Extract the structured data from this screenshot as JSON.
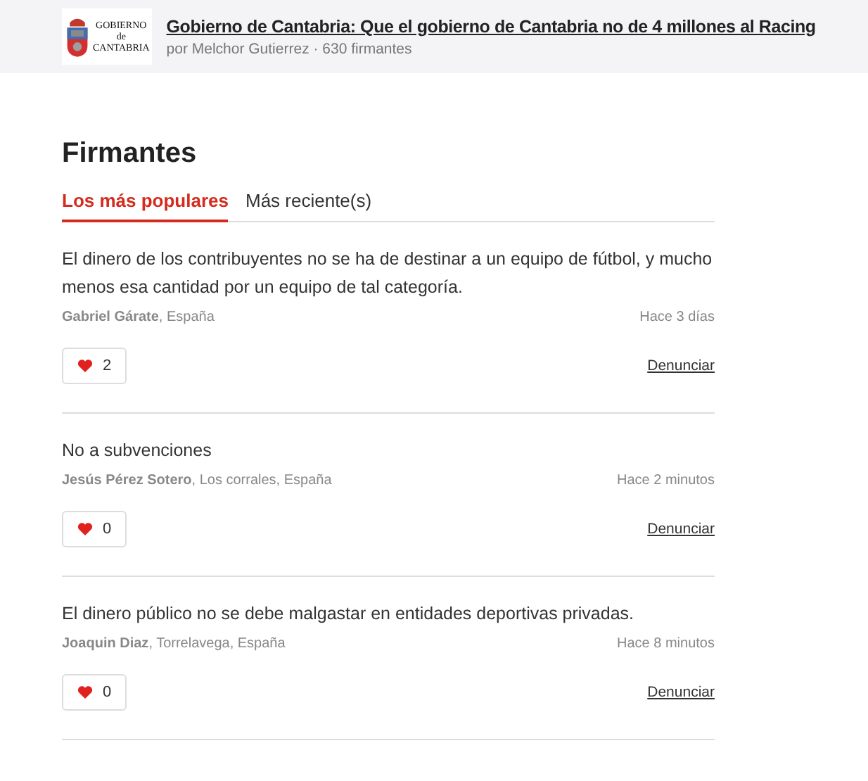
{
  "header": {
    "logo_lines": [
      "GOBIERNO",
      "de",
      "CANTABRIA"
    ],
    "title": "Gobierno de Cantabria: Que el gobierno de Cantabria no de 4 millones al Racing",
    "subtitle": "por Melchor Gutierrez · 630 firmantes"
  },
  "heading": "Firmantes",
  "tabs": [
    {
      "label": "Los más populares",
      "selected": true
    },
    {
      "label": "Más reciente(s)",
      "selected": false
    }
  ],
  "comments": [
    {
      "text": "El dinero de los contribuyentes no se ha de destinar a un equipo de fútbol, y mucho menos esa cantidad por un equipo de tal categoría.",
      "signer": "**Gabriel Gárate**, España",
      "time": "Hace 3 días",
      "likes": "2",
      "report": "Denunciar"
    },
    {
      "text": "No a subvenciones",
      "signer": "**Jesús Pérez Sotero**, Los corrales, España",
      "time": "Hace 2 minutos",
      "likes": "0",
      "report": "Denunciar"
    },
    {
      "text": "El dinero público no se debe malgastar en entidades deportivas privadas.",
      "signer": "**Joaquin Diaz**, Torrelavega, España",
      "time": "Hace 8 minutos",
      "likes": "0",
      "report": "Denunciar"
    }
  ]
}
